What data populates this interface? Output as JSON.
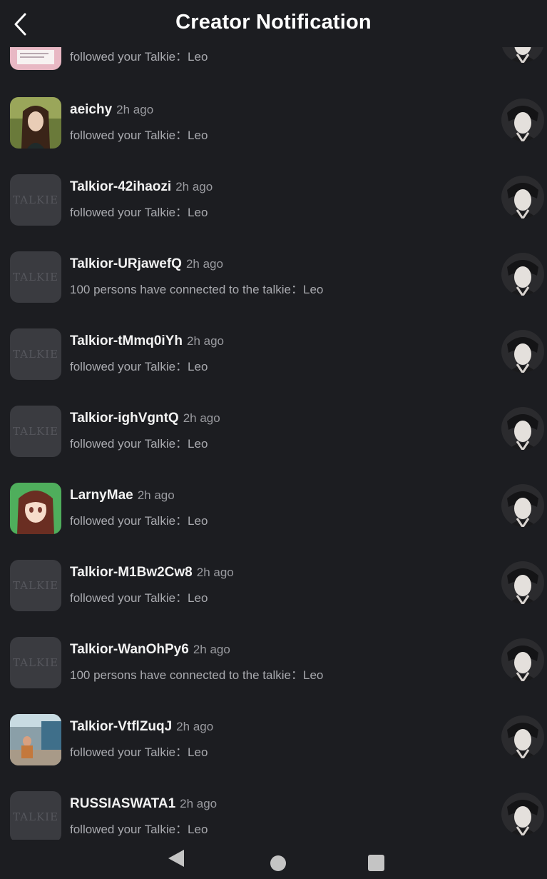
{
  "header": {
    "title": "Creator Notification",
    "back_icon": "chevron-left-icon"
  },
  "notifications": [
    {
      "name": "",
      "time": "",
      "message": "followed your Talkie：Leo",
      "avatar": "anime-girl-pink"
    },
    {
      "name": "aeichy",
      "time": "2h ago",
      "message": "followed your Talkie：Leo",
      "avatar": "brown-hair-girl"
    },
    {
      "name": "Talkior-42ihaozi",
      "time": "2h ago",
      "message": "followed your Talkie：Leo",
      "avatar": "TALKIE"
    },
    {
      "name": "Talkior-URjawefQ",
      "time": "2h ago",
      "message": "100 persons have connected to the talkie：Leo",
      "avatar": "TALKIE"
    },
    {
      "name": "Talkior-tMmq0iYh",
      "time": "2h ago",
      "message": "followed your Talkie：Leo",
      "avatar": "TALKIE"
    },
    {
      "name": "Talkior-ighVgntQ",
      "time": "2h ago",
      "message": "followed your Talkie：Leo",
      "avatar": "TALKIE"
    },
    {
      "name": "LarnyMae",
      "time": "2h ago",
      "message": "followed your Talkie：Leo",
      "avatar": "anime-girl-brown"
    },
    {
      "name": "Talkior-M1Bw2Cw8",
      "time": "2h ago",
      "message": "followed your Talkie：Leo",
      "avatar": "TALKIE"
    },
    {
      "name": "Talkior-WanOhPy6",
      "time": "2h ago",
      "message": "100 persons have connected to the talkie：Leo",
      "avatar": "TALKIE"
    },
    {
      "name": "Talkior-VtflZuqJ",
      "time": "2h ago",
      "message": "followed your Talkie：Leo",
      "avatar": "street-photo"
    },
    {
      "name": "RUSSIASWATA1",
      "time": "2h ago",
      "message": "followed your Talkie：Leo",
      "avatar": "TALKIE"
    }
  ],
  "talkie_avatar": "leo-portrait",
  "nav": {
    "back_icon": "nav-back-icon",
    "home_icon": "nav-home-icon",
    "recent_icon": "nav-recent-icon"
  },
  "colors": {
    "background": "#1c1d21",
    "name_text": "#f2f2f2",
    "secondary_text": "#a9aaaf",
    "placeholder_avatar": "#3a3b40"
  }
}
